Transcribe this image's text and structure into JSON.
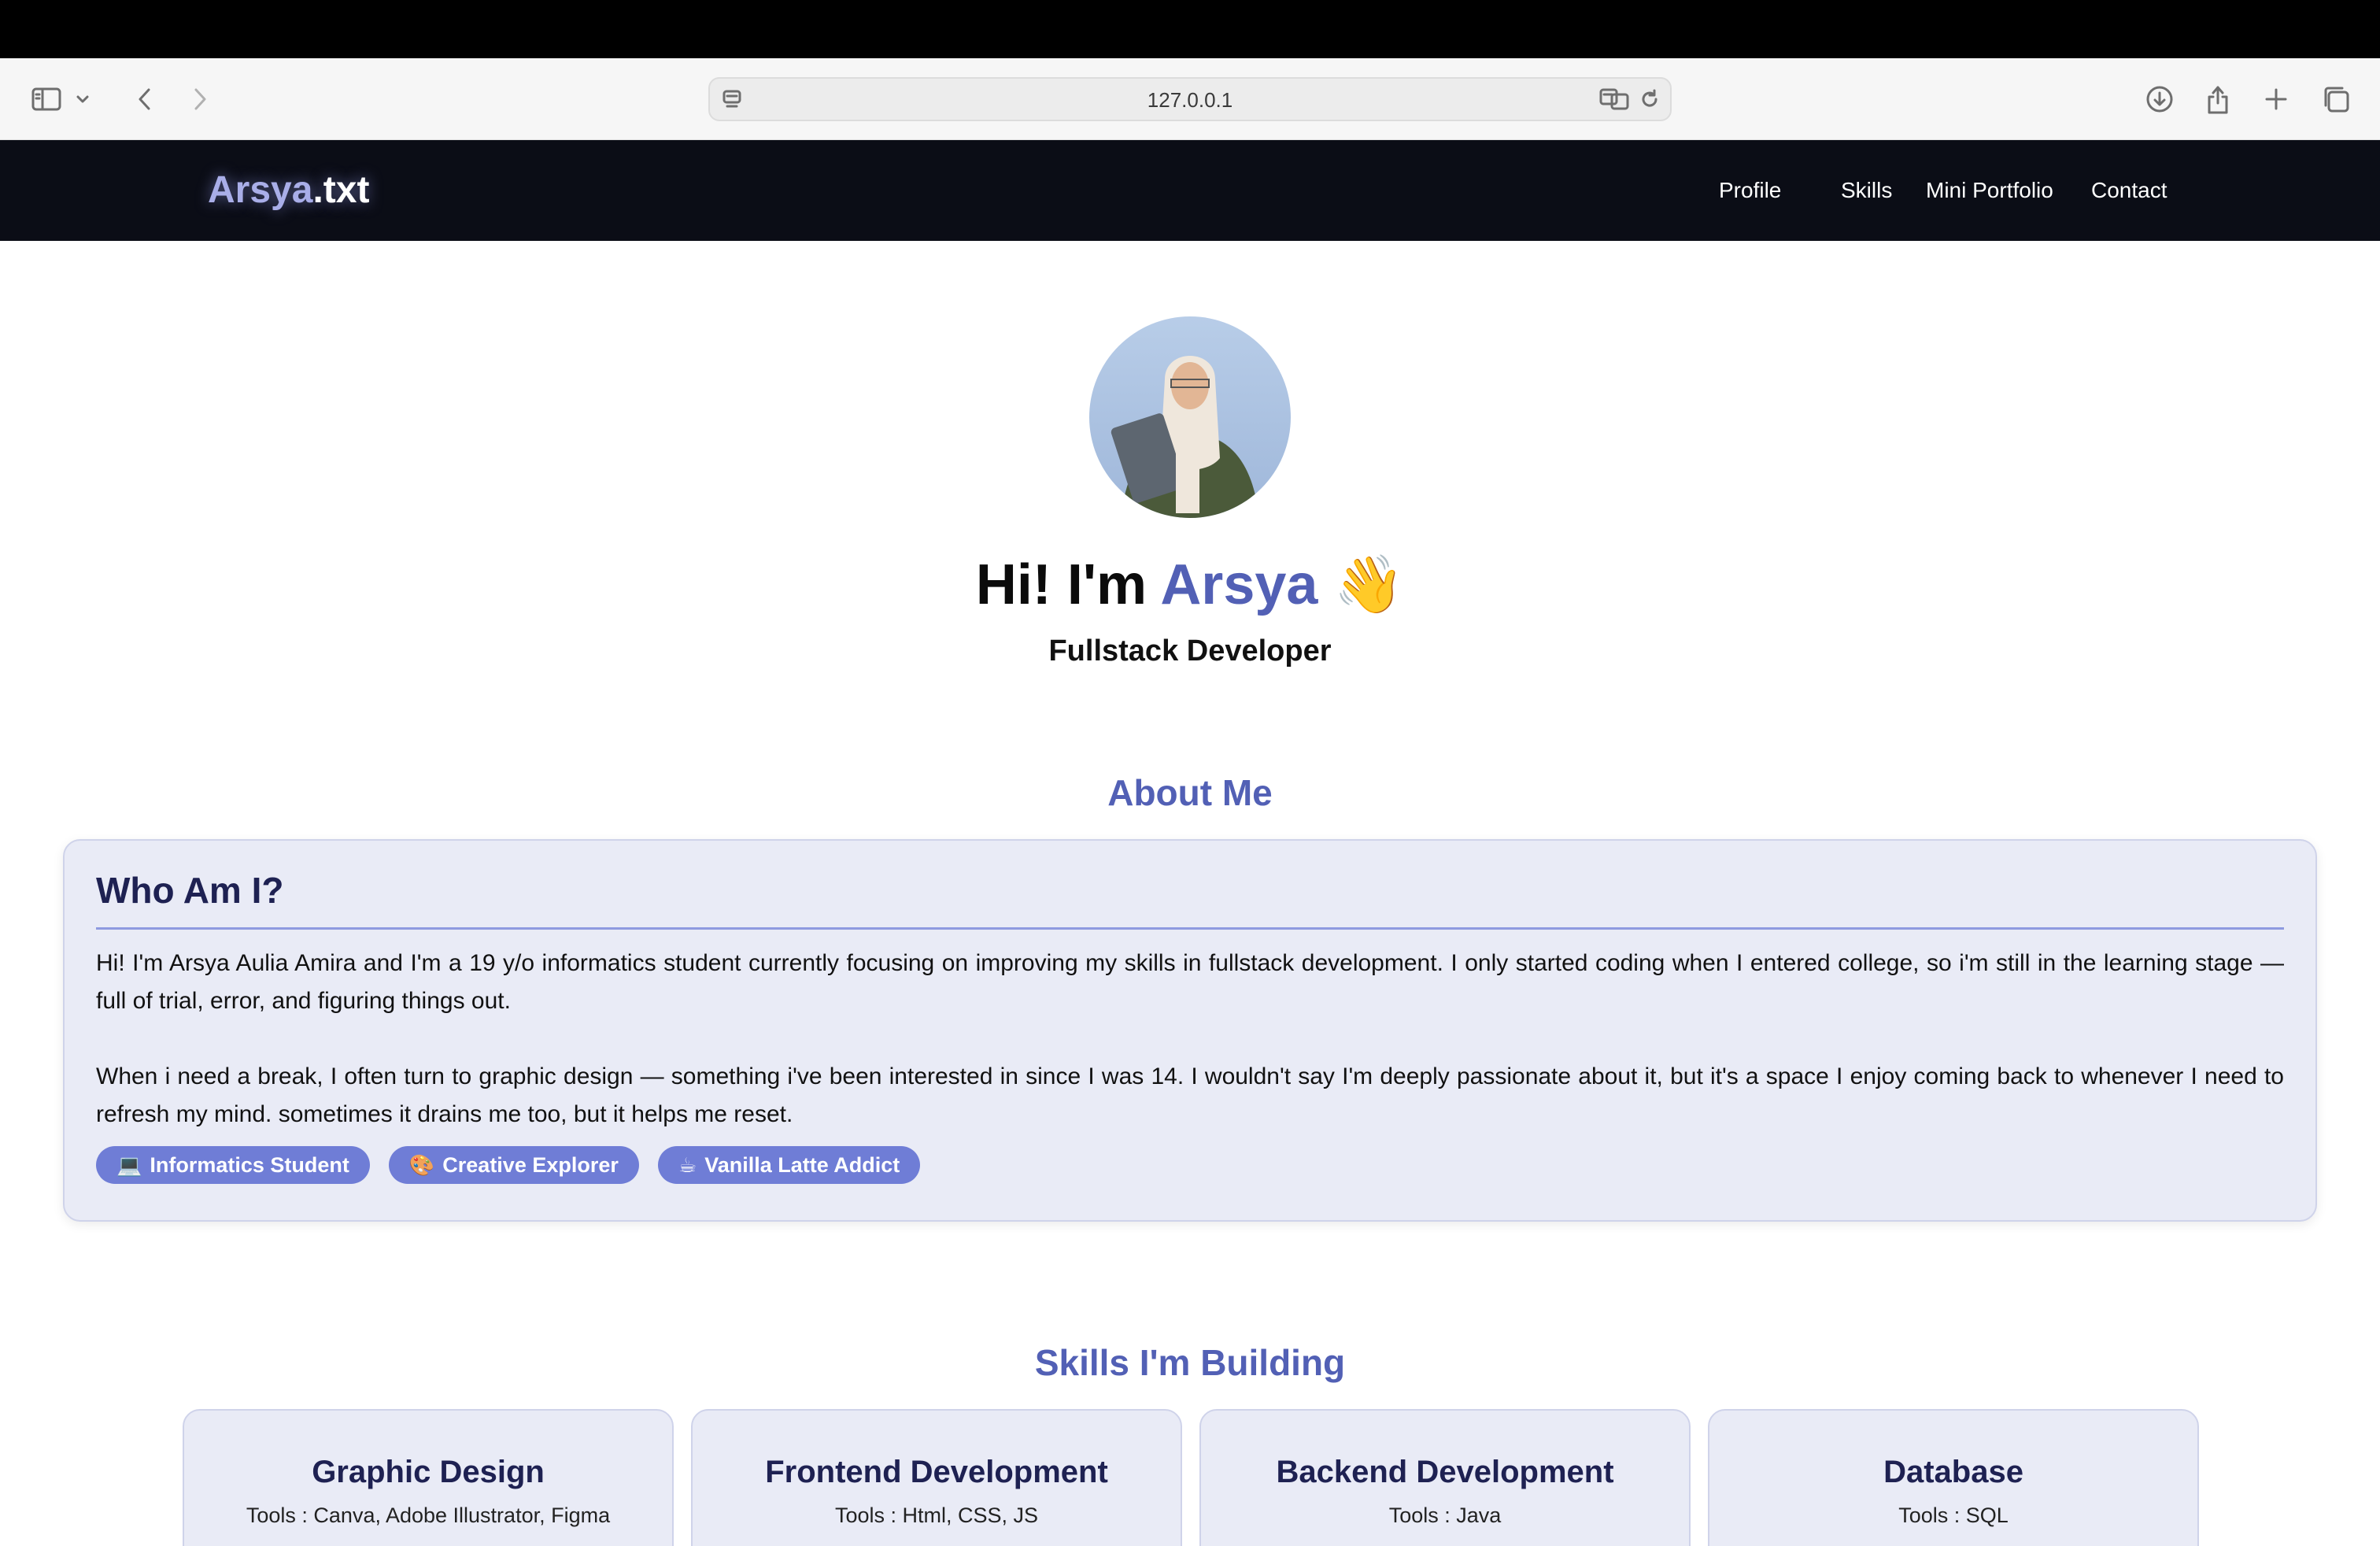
{
  "browser": {
    "url": "127.0.0.1"
  },
  "site": {
    "logo_part1": "Arsya",
    "logo_part2": ".txt",
    "nav": [
      "Profile",
      "Skills",
      "Mini Portfolio",
      "Contact"
    ]
  },
  "hero": {
    "greeting": "Hi! I'm ",
    "name": "Arsya",
    "emoji": "👋",
    "subtitle": "Fullstack Developer"
  },
  "about": {
    "section_title": "About Me",
    "card_title": "Who Am I?",
    "paragraph1": "Hi! I'm Arsya Aulia Amira and I'm a 19 y/o informatics student currently focusing on improving my skills in fullstack development. I only started coding when I entered college, so i'm still in the learning stage — full of trial, error, and figuring things out.",
    "paragraph2": "When i need a break, I often turn to graphic design — something i've been interested in since I was 14. I wouldn't say I'm deeply passionate about it, but it's a space I enjoy coming back to whenever I need to refresh my mind. sometimes it drains me too, but it helps me reset.",
    "tags": [
      {
        "icon": "💻",
        "label": "Informatics Student"
      },
      {
        "icon": "🎨",
        "label": "Creative Explorer"
      },
      {
        "icon": "☕",
        "label": "Vanilla Latte Addict"
      }
    ]
  },
  "skills": {
    "section_title": "Skills I'm Building",
    "cards": [
      {
        "title": "Graphic Design",
        "tools": "Tools : Canva, Adobe Illustrator, Figma"
      },
      {
        "title": "Frontend Development",
        "tools": "Tools : Html, CSS, JS"
      },
      {
        "title": "Backend Development",
        "tools": "Tools : Java"
      },
      {
        "title": "Database",
        "tools": "Tools : SQL"
      }
    ]
  },
  "colors": {
    "accent": "#5260b5",
    "navbar": "#0b0d16",
    "card_bg": "#e9ebf6",
    "tag_bg": "#6f7dd6"
  }
}
